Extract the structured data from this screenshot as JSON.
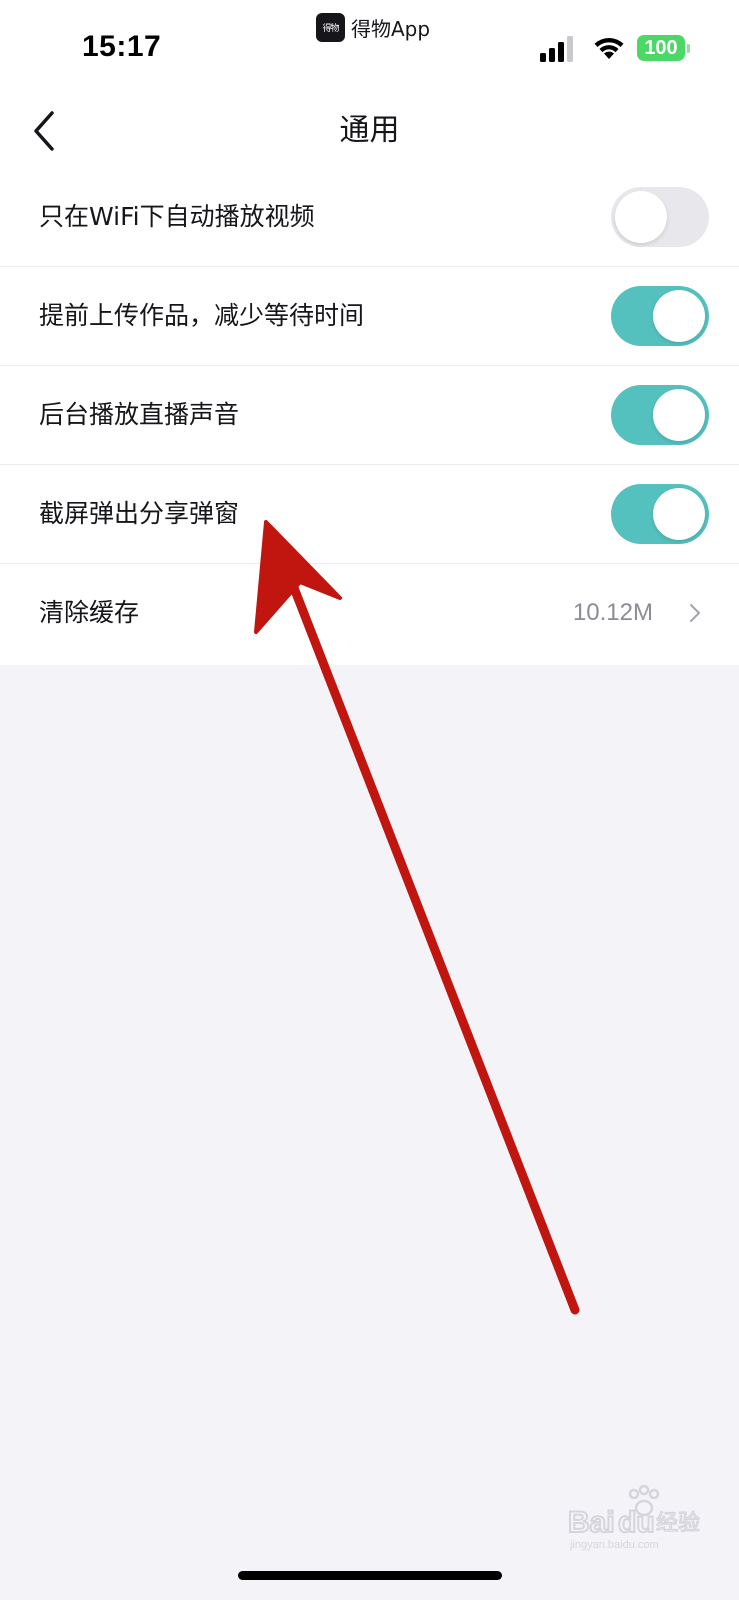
{
  "status_bar": {
    "time": "15:17",
    "app_name": "得物App",
    "app_logo_text": "得物",
    "battery": "100",
    "signal_icon": "cellular-signal-icon",
    "wifi_icon": "wifi-icon"
  },
  "nav": {
    "back_icon": "chevron-left-icon",
    "title": "通用"
  },
  "settings": [
    {
      "label": "只在WiFi下自动播放视频",
      "toggle": false
    },
    {
      "label": "提前上传作品，减少等待时间",
      "toggle": true
    },
    {
      "label": "后台播放直播声音",
      "toggle": true
    },
    {
      "label": "截屏弹出分享弹窗",
      "toggle": true
    }
  ],
  "cache": {
    "label": "清除缓存",
    "value": "10.12M",
    "chevron_icon": "chevron-right-icon"
  },
  "colors": {
    "toggle_on": "#55c1bf",
    "toggle_off": "#e8e8ec",
    "annotation_arrow": "#c0160f",
    "battery": "#4cd864"
  },
  "watermark": {
    "brand": "Baidu",
    "suffix": "经验",
    "url": "jingyan.baidu.com"
  }
}
